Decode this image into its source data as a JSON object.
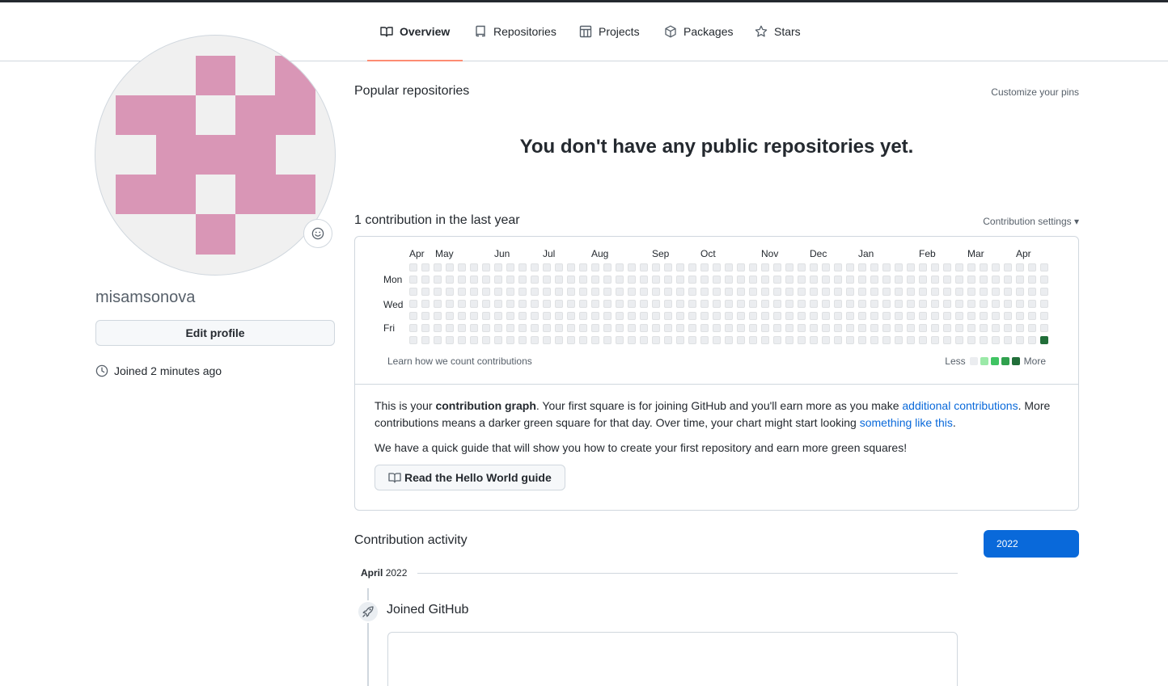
{
  "nav": {
    "tabs": [
      {
        "label": "Overview",
        "icon": "book-icon",
        "selected": true
      },
      {
        "label": "Repositories",
        "icon": "repo-icon",
        "selected": false
      },
      {
        "label": "Projects",
        "icon": "table-icon",
        "selected": false
      },
      {
        "label": "Packages",
        "icon": "package-icon",
        "selected": false
      },
      {
        "label": "Stars",
        "icon": "star-icon",
        "selected": false
      }
    ]
  },
  "profile": {
    "username": "misamsonova",
    "edit_label": "Edit profile",
    "joined_text": "Joined 2 minutes ago",
    "avatar_color": "#d996b6"
  },
  "popular": {
    "title": "Popular repositories",
    "customize_label": "Customize your pins",
    "empty_message": "You don't have any public repositories yet."
  },
  "contributions": {
    "title": "1 contribution in the last year",
    "settings_label": "Contribution settings ▾",
    "months": [
      "Apr",
      "May",
      "Jun",
      "Jul",
      "Aug",
      "Sep",
      "Oct",
      "Nov",
      "Dec",
      "Jan",
      "Feb",
      "Mar",
      "Apr"
    ],
    "days": [
      "Mon",
      "Wed",
      "Fri"
    ],
    "learn_label": "Learn how we count contributions",
    "legend_less": "Less",
    "legend_more": "More",
    "legend_colors": [
      "#ebedf0",
      "#9be9a8",
      "#40c463",
      "#30a14e",
      "#216e39"
    ],
    "active_color": "#216e39",
    "empty_color": "#ebedf0",
    "total_weeks": 53,
    "last_day_index": 6
  },
  "info": {
    "p1_a": "This is your ",
    "p1_b": "contribution graph",
    "p1_c": ". Your first square is for joining GitHub and you'll earn more as you make ",
    "p1_link1": "additional contributions",
    "p1_d": ". More contributions means a darker green square for that day. Over time, your chart might start looking ",
    "p1_link2": "something like this",
    "p1_e": ".",
    "p2": "We have a quick guide that will show you how to create your first repository and earn more green squares!",
    "guide_label": "Read the Hello World guide"
  },
  "activity": {
    "title": "Contribution activity",
    "year": "2022",
    "month_strong": "April",
    "month_year": "2022",
    "event": "Joined GitHub"
  }
}
